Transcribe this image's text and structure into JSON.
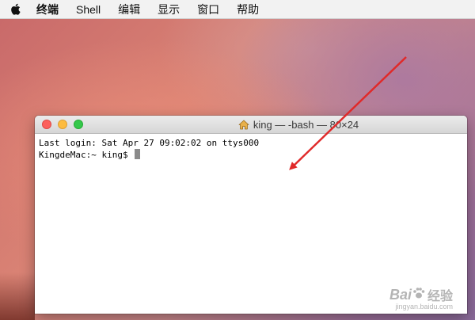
{
  "menubar": {
    "apple_icon": "apple-logo-icon",
    "items": [
      "终端",
      "Shell",
      "编辑",
      "显示",
      "窗口",
      "帮助"
    ]
  },
  "terminal": {
    "title": "king — -bash — 80×24",
    "title_icon": "home-icon",
    "lines": [
      "Last login: Sat Apr 27 09:02:02 on ttys000",
      "KingdeMac:~ king$ "
    ]
  },
  "watermark": {
    "brand": "Bai",
    "brand_suffix": "经验",
    "url": "jingyan.baidu.com"
  },
  "colors": {
    "arrow": "#e02a2a",
    "close": "#fc605c",
    "minimize": "#fdbc40",
    "maximize": "#34c84a"
  }
}
